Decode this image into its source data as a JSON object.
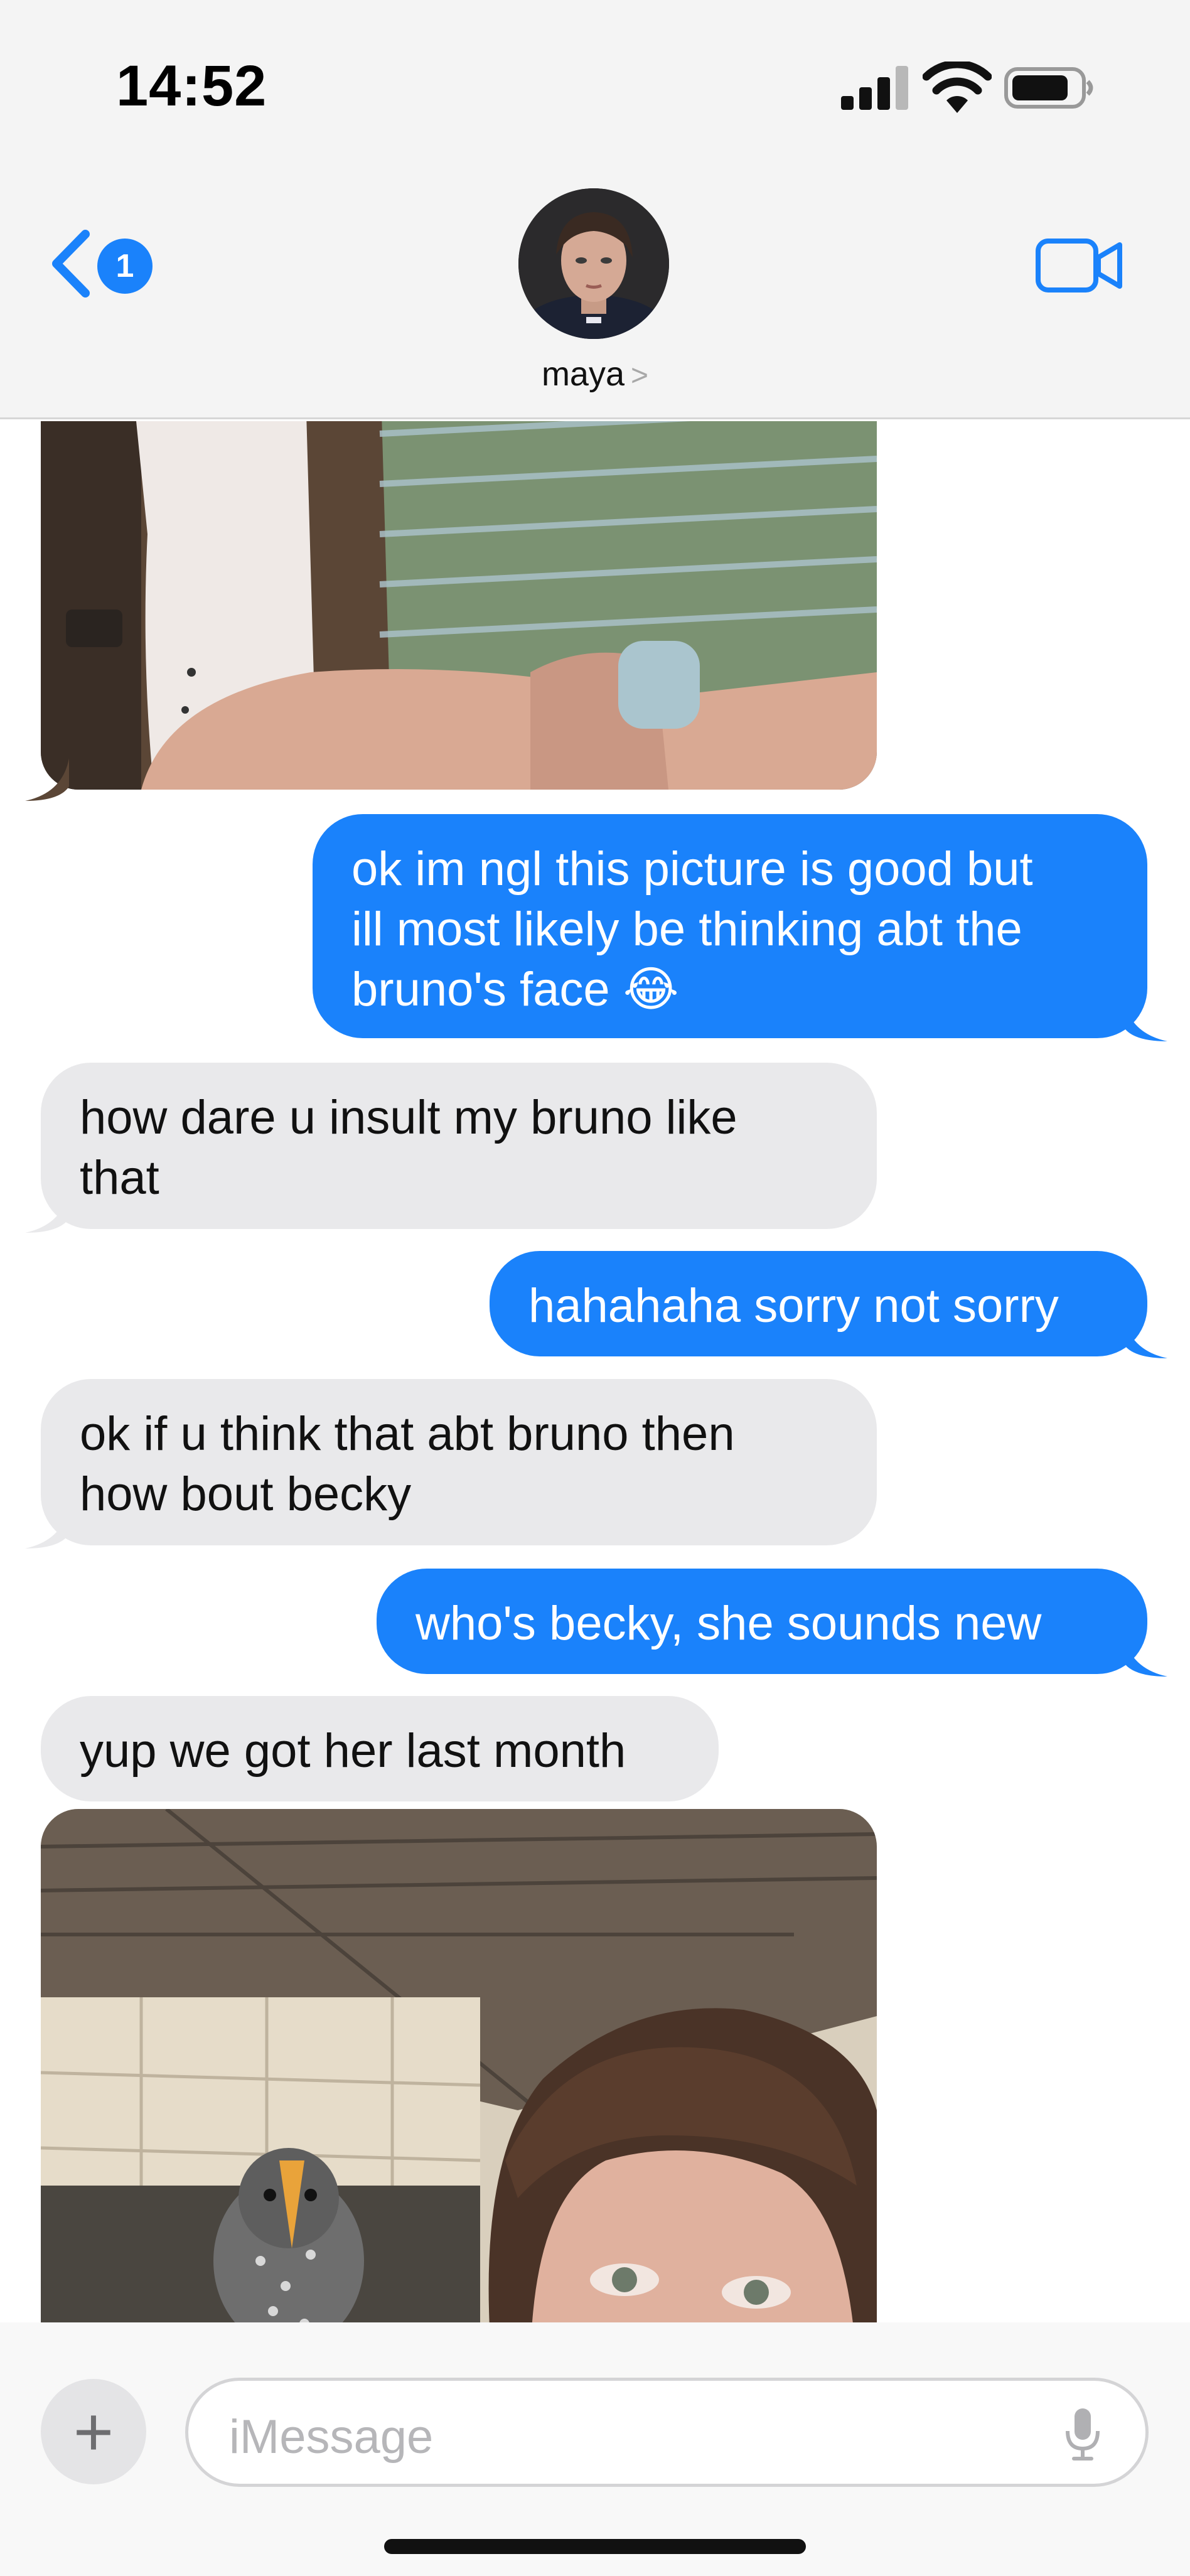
{
  "status_bar": {
    "time": "14:52"
  },
  "header": {
    "back_badge": "1",
    "contact_name": "maya",
    "contact_chevron": ">"
  },
  "messages": [
    {
      "from": "them",
      "type": "image",
      "description_icon": "photo-dog-and-girl"
    },
    {
      "from": "me",
      "type": "text",
      "lines": [
        "ok im ngl this picture is good but",
        "ill most likely be thinking abt the",
        "bruno's face 😂"
      ]
    },
    {
      "from": "them",
      "type": "text",
      "lines": [
        "how dare u insult my bruno like",
        "that"
      ]
    },
    {
      "from": "me",
      "type": "text",
      "lines": [
        "hahahaha sorry not sorry"
      ]
    },
    {
      "from": "them",
      "type": "text",
      "lines": [
        "ok if u think that abt bruno then",
        "how bout becky"
      ]
    },
    {
      "from": "me",
      "type": "text",
      "lines": [
        "who's becky, she sounds new"
      ]
    },
    {
      "from": "them",
      "type": "text",
      "lines": [
        "yup we got her last month"
      ]
    },
    {
      "from": "them",
      "type": "image",
      "description_icon": "photo-bird-and-girl"
    }
  ],
  "composer": {
    "placeholder": "iMessage",
    "plus": "+"
  },
  "colors": {
    "outgoing": "#1a82fb",
    "incoming": "#e9e9eb",
    "accent": "#1a82fb"
  }
}
